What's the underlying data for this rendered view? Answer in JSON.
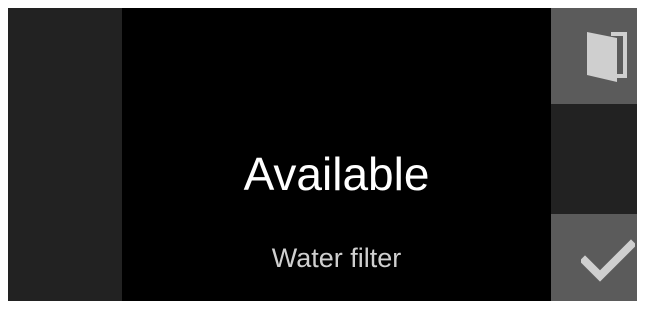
{
  "screen": {
    "status": "Available",
    "item": "Water filter"
  },
  "controls": {
    "door_icon": "door-icon",
    "confirm_icon": "checkmark-icon"
  },
  "colors": {
    "background": "#000000",
    "side_panel": "#222222",
    "button": "#5b5b5b",
    "icon": "#cfcfcf",
    "status_text": "#ffffff",
    "item_text": "#cfcfcf"
  }
}
